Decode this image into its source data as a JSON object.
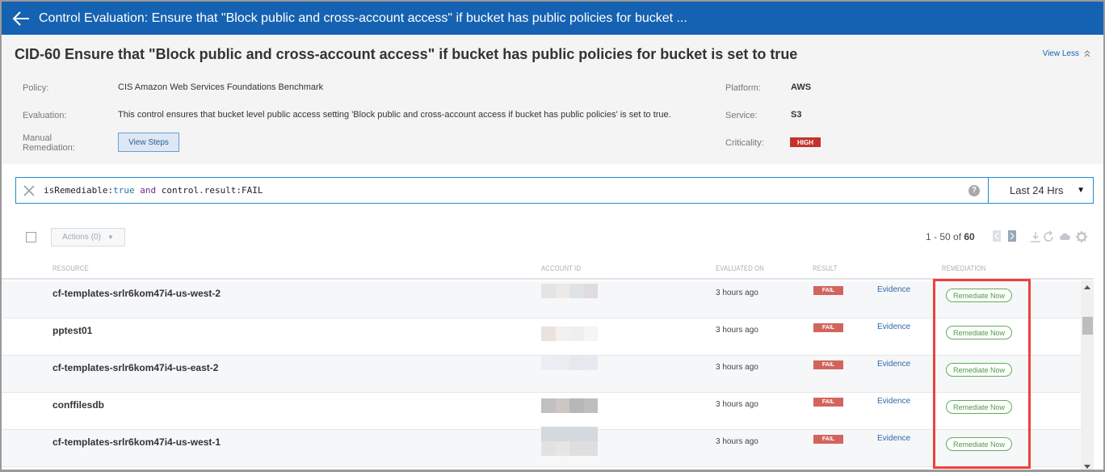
{
  "header": {
    "back_icon": "arrow-left-icon",
    "title": "Control Evaluation: Ensure that \"Block public and cross-account access\" if bucket has public policies for bucket ..."
  },
  "details": {
    "control_title": "CID-60 Ensure that \"Block public and cross-account access\" if bucket has public policies for bucket is set to true",
    "view_less_label": "View Less",
    "view_less_icon": "double-chevron-up-icon",
    "policy_label": "Policy:",
    "policy_value": "CIS Amazon Web Services Foundations Benchmark",
    "evaluation_label": "Evaluation:",
    "evaluation_value": "This control ensures that bucket level public access setting 'Block public and cross-account access if bucket has public policies' is set to true.",
    "manual_remediation_label_line1": "Manual",
    "manual_remediation_label_line2": "Remediation:",
    "view_steps_label": "View Steps",
    "platform_label": "Platform:",
    "platform_value": "AWS",
    "service_label": "Service:",
    "service_value": "S3",
    "criticality_label": "Criticality:",
    "criticality_value": "HIGH",
    "criticality_color": "#c4332b"
  },
  "search": {
    "clear_icon": "close-icon",
    "query_part1": "isRemediable:",
    "query_true": "true",
    "query_and": " and ",
    "query_part2": "control.result:FAIL",
    "help_icon": "help-icon",
    "help_glyph": "?",
    "time_range": "Last 24 Hrs",
    "time_caret": "▼"
  },
  "toolbar": {
    "actions_label": "Actions (0)",
    "actions_caret": "▼",
    "pagination_range": "1 - 50 of ",
    "pagination_total": "60",
    "icons": [
      "chevron-left-icon",
      "chevron-right-icon",
      "download-icon",
      "refresh-icon",
      "cloud-icon",
      "gear-icon"
    ]
  },
  "table": {
    "columns": {
      "resource": "RESOURCE",
      "account_id": "ACCOUNT ID",
      "evaluated_on": "EVALUATED ON",
      "result": "RESULT",
      "remediation": "REMEDIATION"
    },
    "rows": [
      {
        "resource": "cf-templates-srlr6kom47i4-us-west-2",
        "evaluated_on": "3 hours ago",
        "result": "FAIL",
        "evidence": "Evidence",
        "remediation": "Remediate Now"
      },
      {
        "resource": "pptest01",
        "evaluated_on": "3 hours ago",
        "result": "FAIL",
        "evidence": "Evidence",
        "remediation": "Remediate Now"
      },
      {
        "resource": "cf-templates-srlr6kom47i4-us-east-2",
        "evaluated_on": "3 hours ago",
        "result": "FAIL",
        "evidence": "Evidence",
        "remediation": "Remediate Now"
      },
      {
        "resource": "conffilesdb",
        "evaluated_on": "3 hours ago",
        "result": "FAIL",
        "evidence": "Evidence",
        "remediation": "Remediate Now"
      },
      {
        "resource": "cf-templates-srlr6kom47i4-us-west-1",
        "evaluated_on": "3 hours ago",
        "result": "FAIL",
        "evidence": "Evidence",
        "remediation": "Remediate Now"
      }
    ]
  },
  "colors": {
    "header_bg": "#1662b2",
    "fail": "#d2645c",
    "remediate": "#4e9a48",
    "highlight": "#f0403e",
    "link": "#2f68a8"
  }
}
